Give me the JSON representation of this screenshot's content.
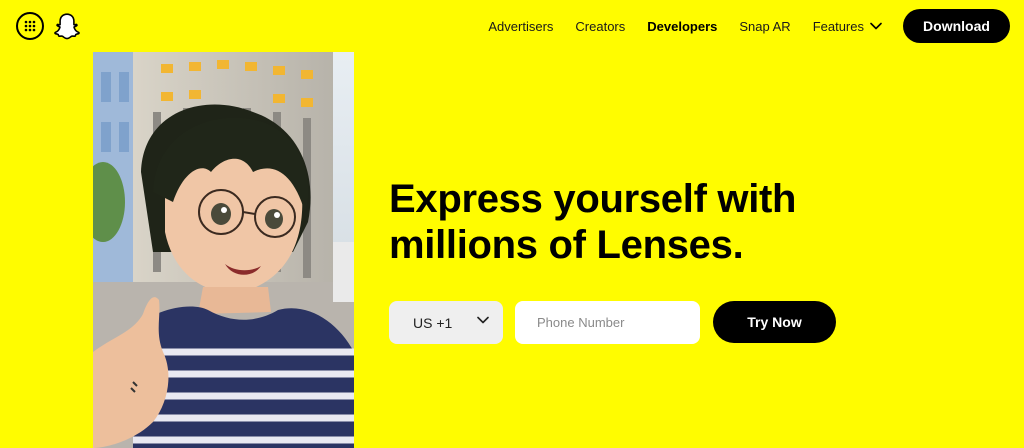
{
  "header": {
    "nav": [
      {
        "label": "Advertisers",
        "active": false
      },
      {
        "label": "Creators",
        "active": false
      },
      {
        "label": "Developers",
        "active": true
      },
      {
        "label": "Snap AR",
        "active": false
      },
      {
        "label": "Features",
        "active": false,
        "has_dropdown": true
      }
    ],
    "download_label": "Download",
    "icons": {
      "menu": "grid-dots-icon",
      "logo": "snapchat-ghost-icon",
      "dropdown": "chevron-down-icon"
    }
  },
  "hero": {
    "headline": "Express yourself with millions of Lenses."
  },
  "form": {
    "country_code": "US +1",
    "phone_placeholder": "Phone Number",
    "phone_value": "",
    "submit_label": "Try Now"
  },
  "colors": {
    "background": "#FFFC00",
    "primary": "#000000",
    "select_bg": "#EFEFEF",
    "input_bg": "#FFFFFF"
  }
}
